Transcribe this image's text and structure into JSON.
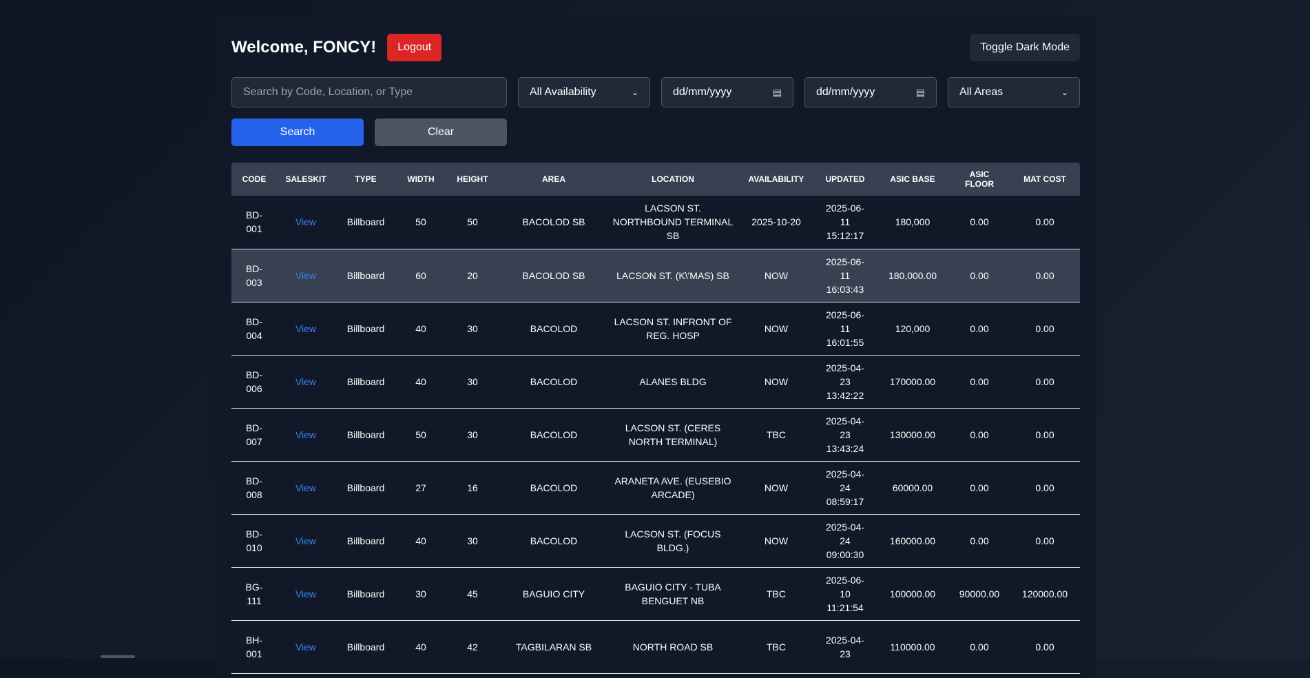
{
  "header": {
    "welcome": "Welcome, FONCY!",
    "logout_label": "Logout",
    "toggle_label": "Toggle Dark Mode"
  },
  "filters": {
    "search_placeholder": "Search by Code, Location, or Type",
    "availability_selected": "All Availability",
    "date_from_placeholder": "dd/mm/yyyy",
    "date_to_placeholder": "dd/mm/yyyy",
    "area_selected": "All Areas"
  },
  "actions": {
    "search_label": "Search",
    "clear_label": "Clear"
  },
  "table": {
    "columns": [
      "CODE",
      "SALESKIT",
      "TYPE",
      "WIDTH",
      "HEIGHT",
      "AREA",
      "LOCATION",
      "AVAILABILITY",
      "UPDATED",
      "ASIC BASE",
      "ASIC FLOOR",
      "MAT COST"
    ],
    "rows": [
      {
        "code": "BD-001",
        "saleskit": "View",
        "type": "Billboard",
        "width": "50",
        "height": "50",
        "area": "BACOLOD SB",
        "location": "LACSON ST. NORTHBOUND TERMINAL SB",
        "availability": "2025-10-20",
        "updated": "2025-06-11 15:12:17",
        "asic_base": "180,000",
        "asic_floor": "0.00",
        "mat_cost": "0.00"
      },
      {
        "code": "BD-003",
        "saleskit": "View",
        "type": "Billboard",
        "width": "60",
        "height": "20",
        "area": "BACOLOD SB",
        "location": "LACSON ST. (K\\'MAS) SB",
        "availability": "NOW",
        "updated": "2025-06-11 16:03:43",
        "asic_base": "180,000.00",
        "asic_floor": "0.00",
        "mat_cost": "0.00"
      },
      {
        "code": "BD-004",
        "saleskit": "View",
        "type": "Billboard",
        "width": "40",
        "height": "30",
        "area": "BACOLOD",
        "location": "LACSON ST. INFRONT OF REG. HOSP",
        "availability": "NOW",
        "updated": "2025-06-11 16:01:55",
        "asic_base": "120,000",
        "asic_floor": "0.00",
        "mat_cost": "0.00"
      },
      {
        "code": "BD-006",
        "saleskit": "View",
        "type": "Billboard",
        "width": "40",
        "height": "30",
        "area": "BACOLOD",
        "location": "ALANES BLDG",
        "availability": "NOW",
        "updated": "2025-04-23 13:42:22",
        "asic_base": "170000.00",
        "asic_floor": "0.00",
        "mat_cost": "0.00"
      },
      {
        "code": "BD-007",
        "saleskit": "View",
        "type": "Billboard",
        "width": "50",
        "height": "30",
        "area": "BACOLOD",
        "location": "LACSON ST. (CERES NORTH TERMINAL)",
        "availability": "TBC",
        "updated": "2025-04-23 13:43:24",
        "asic_base": "130000.00",
        "asic_floor": "0.00",
        "mat_cost": "0.00"
      },
      {
        "code": "BD-008",
        "saleskit": "View",
        "type": "Billboard",
        "width": "27",
        "height": "16",
        "area": "BACOLOD",
        "location": "ARANETA AVE. (EUSEBIO ARCADE)",
        "availability": "NOW",
        "updated": "2025-04-24 08:59:17",
        "asic_base": "60000.00",
        "asic_floor": "0.00",
        "mat_cost": "0.00"
      },
      {
        "code": "BD-010",
        "saleskit": "View",
        "type": "Billboard",
        "width": "40",
        "height": "30",
        "area": "BACOLOD",
        "location": "LACSON ST. (FOCUS BLDG.)",
        "availability": "NOW",
        "updated": "2025-04-24 09:00:30",
        "asic_base": "160000.00",
        "asic_floor": "0.00",
        "mat_cost": "0.00"
      },
      {
        "code": "BG-111",
        "saleskit": "View",
        "type": "Billboard",
        "width": "30",
        "height": "45",
        "area": "BAGUIO CITY",
        "location": "BAGUIO CITY - TUBA BENGUET NB",
        "availability": "TBC",
        "updated": "2025-06-10 11:21:54",
        "asic_base": "100000.00",
        "asic_floor": "90000.00",
        "mat_cost": "120000.00"
      },
      {
        "code": "BH-001",
        "saleskit": "View",
        "type": "Billboard",
        "width": "40",
        "height": "42",
        "area": "TAGBILARAN SB",
        "location": "NORTH ROAD SB",
        "availability": "TBC",
        "updated": "2025-04-23",
        "asic_base": "110000.00",
        "asic_floor": "0.00",
        "mat_cost": "0.00"
      }
    ]
  }
}
